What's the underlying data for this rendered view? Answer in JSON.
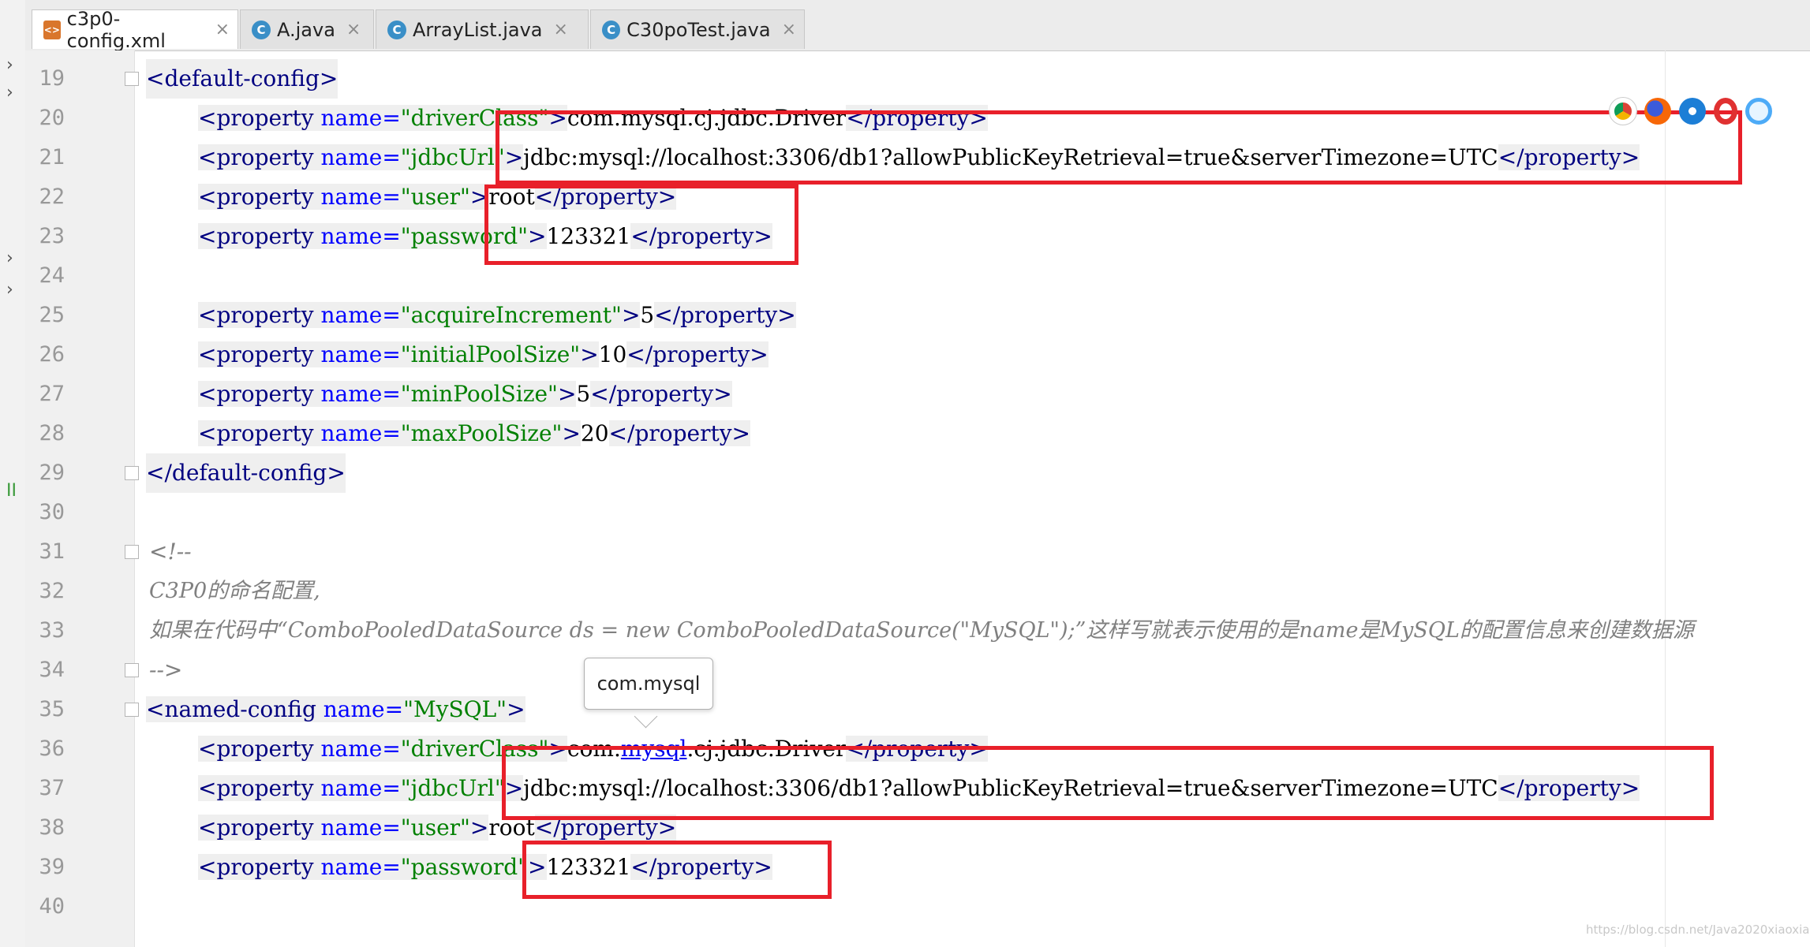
{
  "tabs": [
    {
      "label": "c3p0-config.xml",
      "icon": "xml-file-icon",
      "active": true
    },
    {
      "label": "A.java",
      "icon": "java-class-icon",
      "active": false
    },
    {
      "label": "ArrayList.java",
      "icon": "java-class-icon",
      "active": false
    },
    {
      "label": "C30poTest.java",
      "icon": "java-class-icon",
      "active": false
    }
  ],
  "tab_close": "×",
  "left_strip_marks": [
    "›",
    "›",
    "›",
    "›",
    "›",
    "II"
  ],
  "line_numbers": [
    "19",
    "20",
    "21",
    "22",
    "23",
    "24",
    "25",
    "26",
    "27",
    "28",
    "29",
    "30",
    "31",
    "32",
    "33",
    "34",
    "35",
    "36",
    "37",
    "38",
    "39",
    "40"
  ],
  "code": {
    "l19": {
      "tag_open": "<default-config>"
    },
    "l20": {
      "p1": "<property ",
      "p2": "name=",
      "p3": "\"driverClass\"",
      "p4": ">",
      "p5": "com.mysql.cj.jdbc.Driver",
      "p6": "</property>"
    },
    "l21": {
      "p1": "<property ",
      "p2": "name=",
      "p3": "\"jdbcUrl\"",
      "p4": ">",
      "p5": "jdbc:mysql://localhost:3306/db1?allowPublicKeyRetrieval=true&serverTimezone=UTC",
      "p6": "</property>"
    },
    "l22": {
      "p1": "<property ",
      "p2": "name=",
      "p3": "\"user\"",
      "p4": ">",
      "p5": "root",
      "p6": "</property>"
    },
    "l23": {
      "p1": "<property ",
      "p2": "name=",
      "p3": "\"password\"",
      "p4": ">",
      "p5": "123321",
      "p6": "</property>"
    },
    "l25": {
      "p1": "<property ",
      "p2": "name=",
      "p3": "\"acquireIncrement\"",
      "p4": ">",
      "p5": "5",
      "p6": "</property>"
    },
    "l26": {
      "p1": "<property ",
      "p2": "name=",
      "p3": "\"initialPoolSize\"",
      "p4": ">",
      "p5": "10",
      "p6": "</property>"
    },
    "l27": {
      "p1": "<property ",
      "p2": "name=",
      "p3": "\"minPoolSize\"",
      "p4": ">",
      "p5": "5",
      "p6": "</property>"
    },
    "l28": {
      "p1": "<property ",
      "p2": "name=",
      "p3": "\"maxPoolSize\"",
      "p4": ">",
      "p5": "20",
      "p6": "</property>"
    },
    "l29": {
      "tag_close": "</default-config>"
    },
    "l31": {
      "comment": "<!--"
    },
    "l32": {
      "comment": "C3P0的命名配置,"
    },
    "l33": {
      "comment": "如果在代码中“ComboPooledDataSource ds = new ComboPooledDataSource(\"MySQL\");”这样写就表示使用的是name是MySQL的配置信息来创建数据源"
    },
    "l34": {
      "comment": "-->"
    },
    "l35": {
      "p1": "<named-config ",
      "p2": "name=",
      "p3": "\"MySQL\"",
      "p4": ">"
    },
    "l36": {
      "p1": "<property ",
      "p2": "name=",
      "p3": "\"driverClass\"",
      "p4": ">",
      "p5a": "com.",
      "p5b": "mysql",
      "p5c": ".cj.jdbc.Driver",
      "p6": "</property>"
    },
    "l37": {
      "p1": "<property ",
      "p2": "name=",
      "p3": "\"jdbcUrl\"",
      "p4": ">",
      "p5": "jdbc:mysql://localhost:3306/db1?allowPublicKeyRetrieval=true&serverTimezone=UTC",
      "p6": "</property>"
    },
    "l38": {
      "p1": "<property ",
      "p2": "name=",
      "p3": "\"user\"",
      "p4": ">",
      "p5": "root",
      "p6": "</property>"
    },
    "l39": {
      "p1": "<property ",
      "p2": "name=",
      "p3": "\"password\"",
      "p4": ">",
      "p5": "123321",
      "p6": "</property>"
    }
  },
  "tooltip": {
    "text": "com.mysql"
  },
  "browser_icons": [
    "chrome-icon",
    "firefox-icon",
    "safari-icon",
    "opera-icon",
    "ie-icon"
  ],
  "colors": {
    "annotation_red": "#e8202a",
    "xml_tag": "#000080",
    "xml_attr": "#0000ff",
    "xml_value": "#008000",
    "comment": "#808080"
  },
  "watermark": "https://blog.csdn.net/Java2020xiaoxian"
}
